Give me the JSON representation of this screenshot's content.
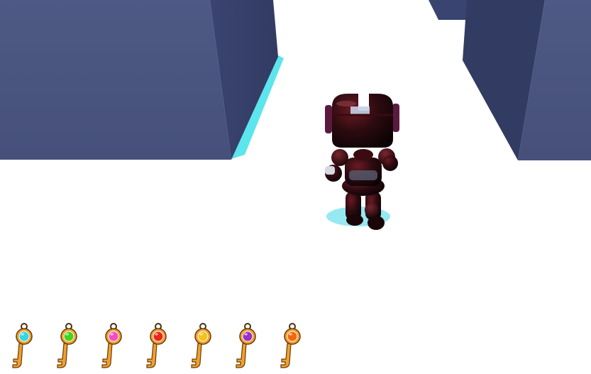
{
  "scene": {
    "type": "3d-maze-runner",
    "floor_color": "#ffffff",
    "wall_color_face": "#4a5580",
    "wall_color_side": "#374068",
    "wall_shadow_color": "#3fe0ea"
  },
  "player": {
    "character": "robot",
    "body_color": "#2a0c10",
    "accent_color": "#ffffff"
  },
  "keys": [
    {
      "name": "cyan-key",
      "gem_color": "#35d6e6"
    },
    {
      "name": "green-key",
      "gem_color": "#44d21e"
    },
    {
      "name": "pink-key",
      "gem_color": "#f04fc0"
    },
    {
      "name": "red-key",
      "gem_color": "#e8261c"
    },
    {
      "name": "yellow-key",
      "gem_color": "#f5c21a"
    },
    {
      "name": "purple-key",
      "gem_color": "#9632c8"
    },
    {
      "name": "orange-key",
      "gem_color": "#f2680e"
    }
  ],
  "key_body_color": "#f0a030"
}
